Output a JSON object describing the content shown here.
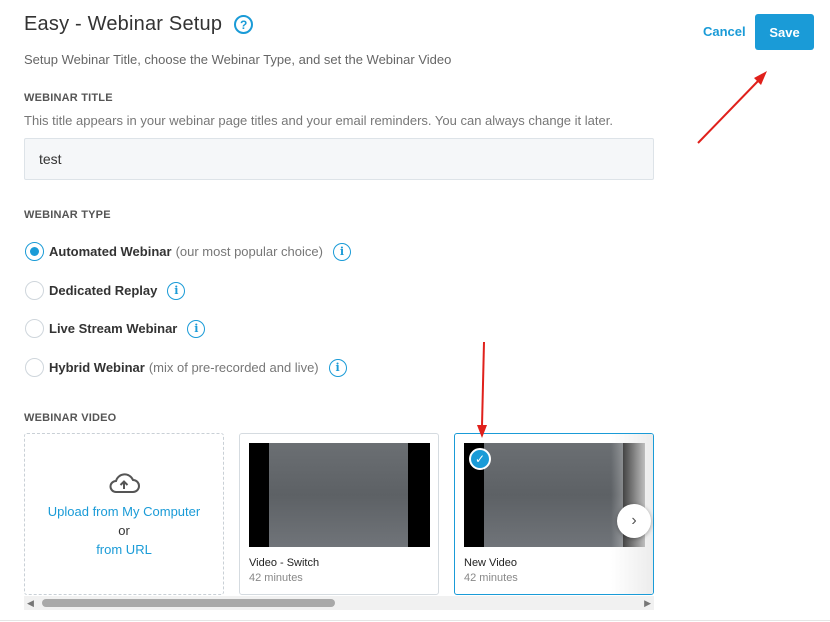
{
  "header": {
    "title": "Easy - Webinar Setup",
    "help_icon": "question-circle-icon",
    "subtitle": "Setup Webinar Title, choose the Webinar Type, and set the Webinar Video"
  },
  "actions": {
    "cancel_label": "Cancel",
    "save_label": "Save"
  },
  "title_section": {
    "label": "WEBINAR TITLE",
    "helper": "This title appears in your webinar page titles and your email reminders. You can always change it later.",
    "value": "test"
  },
  "type_section": {
    "label": "WEBINAR TYPE",
    "options": [
      {
        "label": "Automated Webinar",
        "note": "(our most popular choice)",
        "checked": true
      },
      {
        "label": "Dedicated Replay",
        "note": "",
        "checked": false
      },
      {
        "label": "Live Stream Webinar",
        "note": "",
        "checked": false
      },
      {
        "label": "Hybrid Webinar",
        "note": "(mix of pre-recorded and live)",
        "checked": false
      }
    ]
  },
  "video_section": {
    "label": "WEBINAR VIDEO",
    "upload": {
      "computer_label": "Upload from My Computer",
      "or_label": "or",
      "url_label": "from URL"
    },
    "videos": [
      {
        "name": "Video - Switch",
        "duration": "42 minutes",
        "selected": false
      },
      {
        "name": "New Video",
        "duration": "42 minutes",
        "selected": true
      }
    ]
  },
  "colors": {
    "accent": "#1a9bd7",
    "annotation_arrow": "#e0201b"
  }
}
